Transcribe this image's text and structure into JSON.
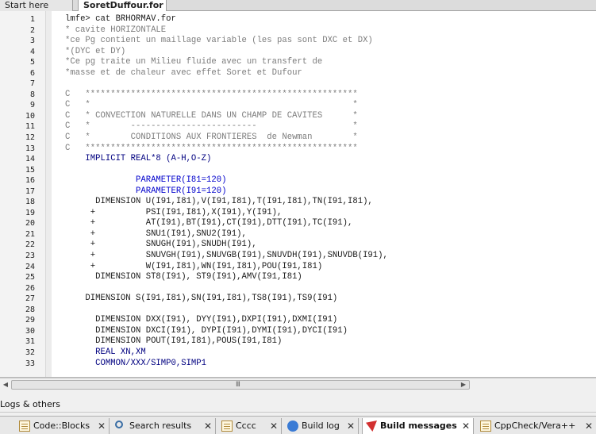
{
  "tabs": [
    {
      "label": "Start here",
      "active": false
    },
    {
      "label": "SoretDuffour.for",
      "active": true
    }
  ],
  "editor": {
    "lines": [
      {
        "n": "1",
        "text": "lmfe> cat BRHORMAV.for",
        "kind": "plain"
      },
      {
        "n": "2",
        "text": "* cavite HORIZONTALE",
        "kind": "comment"
      },
      {
        "n": "3",
        "text": "*ce Pg contient un maillage variable (les pas sont DXC et DX)",
        "kind": "comment"
      },
      {
        "n": "4",
        "text": "*(DYC et DY)",
        "kind": "comment"
      },
      {
        "n": "5",
        "text": "*Ce pg traite un Milieu fluide avec un transfert de",
        "kind": "comment"
      },
      {
        "n": "6",
        "text": "*masse et de chaleur avec effet Soret et Dufour",
        "kind": "comment"
      },
      {
        "n": "7",
        "text": "",
        "kind": "plain"
      },
      {
        "n": "8",
        "text": "C   ******************************************************",
        "kind": "comment"
      },
      {
        "n": "9",
        "text": "C   *                                                    *",
        "kind": "comment"
      },
      {
        "n": "10",
        "text": "C   * CONVECTION NATURELLE DANS UN CHAMP DE CAVITES      *",
        "kind": "comment"
      },
      {
        "n": "11",
        "text": "C   *        -------------------------                   *",
        "kind": "comment"
      },
      {
        "n": "12",
        "text": "C   *        CONDITIONS AUX FRONTIERES  de Newman        *",
        "kind": "comment"
      },
      {
        "n": "13",
        "text": "C   ******************************************************",
        "kind": "comment"
      },
      {
        "n": "14",
        "text": "    IMPLICIT REAL*8 (A-H,O-Z)",
        "kind": "kw"
      },
      {
        "n": "15",
        "text": "",
        "kind": "plain"
      },
      {
        "n": "16",
        "text": "              PARAMETER(I81=120)",
        "kind": "param"
      },
      {
        "n": "17",
        "text": "              PARAMETER(I91=120)",
        "kind": "param"
      },
      {
        "n": "18",
        "text": "      DIMENSION U(I91,I81),V(I91,I81),T(I91,I81),TN(I91,I81),",
        "kind": "dim"
      },
      {
        "n": "19",
        "text": "     +          PSI(I91,I81),X(I91),Y(I91),",
        "kind": "cont"
      },
      {
        "n": "20",
        "text": "     +          AT(I91),BT(I91),CT(I91),DTT(I91),TC(I91),",
        "kind": "cont"
      },
      {
        "n": "21",
        "text": "     +          SNU1(I91),SNU2(I91),",
        "kind": "cont"
      },
      {
        "n": "22",
        "text": "     +          SNUGH(I91),SNUDH(I91),",
        "kind": "cont"
      },
      {
        "n": "23",
        "text": "     +          SNUVGH(I91),SNUVGB(I91),SNUVDH(I91),SNUVDB(I91),",
        "kind": "cont"
      },
      {
        "n": "24",
        "text": "     +          W(I91,I81),WN(I91,I81),POU(I91,I81)",
        "kind": "cont"
      },
      {
        "n": "25",
        "text": "      DIMENSION ST8(I91), ST9(I91),AMV(I91,I81)",
        "kind": "dim"
      },
      {
        "n": "26",
        "text": "",
        "kind": "plain"
      },
      {
        "n": "27",
        "text": "    DIMENSION S(I91,I81),SN(I91,I81),TS8(I91),TS9(I91)",
        "kind": "dim"
      },
      {
        "n": "28",
        "text": "",
        "kind": "plain"
      },
      {
        "n": "29",
        "text": "      DIMENSION DXX(I91), DYY(I91),DXPI(I91),DXMI(I91)",
        "kind": "dim"
      },
      {
        "n": "30",
        "text": "      DIMENSION DXCI(I91), DYPI(I91),DYMI(I91),DYCI(I91)",
        "kind": "dim"
      },
      {
        "n": "31",
        "text": "      DIMENSION POUT(I91,I81),POUS(I91,I81)",
        "kind": "dim"
      },
      {
        "n": "32",
        "text": "      REAL XN,XM",
        "kind": "kw"
      },
      {
        "n": "33",
        "text": "      COMMON/XXX/SIMP0,SIMP1",
        "kind": "kw"
      }
    ]
  },
  "scrollbar": {
    "grip": "III"
  },
  "logs": {
    "title": "Logs & others"
  },
  "bottom_tabs": [
    {
      "label": "Code::Blocks",
      "icon": "document-icon",
      "active": false
    },
    {
      "label": "Search results",
      "icon": "search-icon",
      "active": false
    },
    {
      "label": "Cccc",
      "icon": "document-icon",
      "active": false
    },
    {
      "label": "Build log",
      "icon": "build-icon",
      "active": false
    },
    {
      "label": "Build messages",
      "icon": "message-icon",
      "active": true
    },
    {
      "label": "CppCheck/Vera++",
      "icon": "document-icon",
      "active": false
    }
  ]
}
